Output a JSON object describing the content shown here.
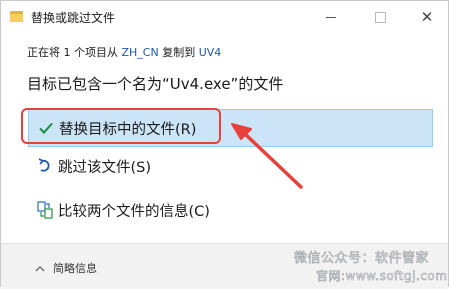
{
  "window": {
    "title": "替换或跳过文件",
    "minimize_icon": "minimize-icon",
    "maximize_icon": "maximize-icon",
    "close_icon": "close-icon",
    "close_glyph": "✕"
  },
  "copy_info": {
    "prefix": "正在将 1 个项目从",
    "source": "ZH_CN",
    "middle": "复制到",
    "destination": "UV4"
  },
  "heading": "目标已包含一个名为“Uv4.exe”的文件",
  "options": [
    {
      "label": "替换目标中的文件(R)",
      "icon": "checkmark-icon",
      "icon_color": "#1a8f3c",
      "selected": true
    },
    {
      "label": "跳过该文件(S)",
      "icon": "skip-icon",
      "icon_color": "#1f5aa6",
      "selected": false
    },
    {
      "label": "比较两个文件的信息(C)",
      "icon": "compare-files-icon",
      "icon_color": "#1f5aa6",
      "selected": false
    }
  ],
  "footer": {
    "details_label": "简略信息",
    "details_icon": "chevron-up-icon"
  },
  "watermark": {
    "line1": "微信公众号：软件管家",
    "line2": "官网:www.softgj.com"
  },
  "colors": {
    "selected_bg": "#cce4f7",
    "link": "#1f5aa6",
    "annotation": "#e8403a"
  }
}
